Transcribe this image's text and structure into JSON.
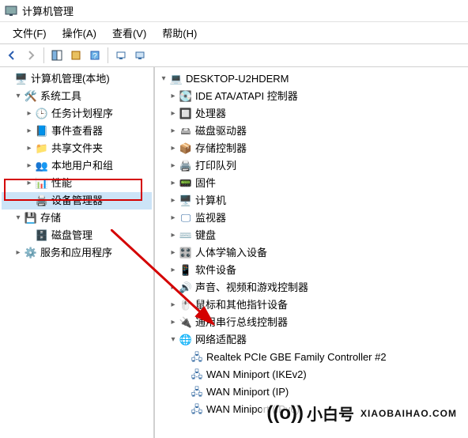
{
  "title": "计算机管理",
  "menu": {
    "file": "文件(F)",
    "action": "操作(A)",
    "view": "查看(V)",
    "help": "帮助(H)"
  },
  "left": {
    "root": "计算机管理(本地)",
    "sysTools": "系统工具",
    "taskSched": "任务计划程序",
    "eventViewer": "事件查看器",
    "sharedFolders": "共享文件夹",
    "localUsers": "本地用户和组",
    "performance": "性能",
    "deviceMgr": "设备管理器",
    "storage": "存储",
    "diskMgmt": "磁盘管理",
    "services": "服务和应用程序"
  },
  "right": {
    "host": "DESKTOP-U2HDERM",
    "ide": "IDE ATA/ATAPI 控制器",
    "cpu": "处理器",
    "disk": "磁盘驱动器",
    "storageCtrl": "存储控制器",
    "printQueue": "打印队列",
    "firmware": "固件",
    "computer": "计算机",
    "monitor": "监视器",
    "keyboard": "键盘",
    "hid": "人体学输入设备",
    "software": "软件设备",
    "audio": "声音、视频和游戏控制器",
    "mouse": "鼠标和其他指针设备",
    "usb": "通用串行总线控制器",
    "netAdapters": "网络适配器",
    "nic0": "Realtek PCIe GBE Family Controller #2",
    "nic1": "WAN Miniport (IKEv2)",
    "nic2": "WAN Miniport (IP)",
    "nic3": "WAN Miniport (IPv6)"
  },
  "watermark": {
    "text": "小白号",
    "sub": "XIAOBAIHAO.COM"
  }
}
